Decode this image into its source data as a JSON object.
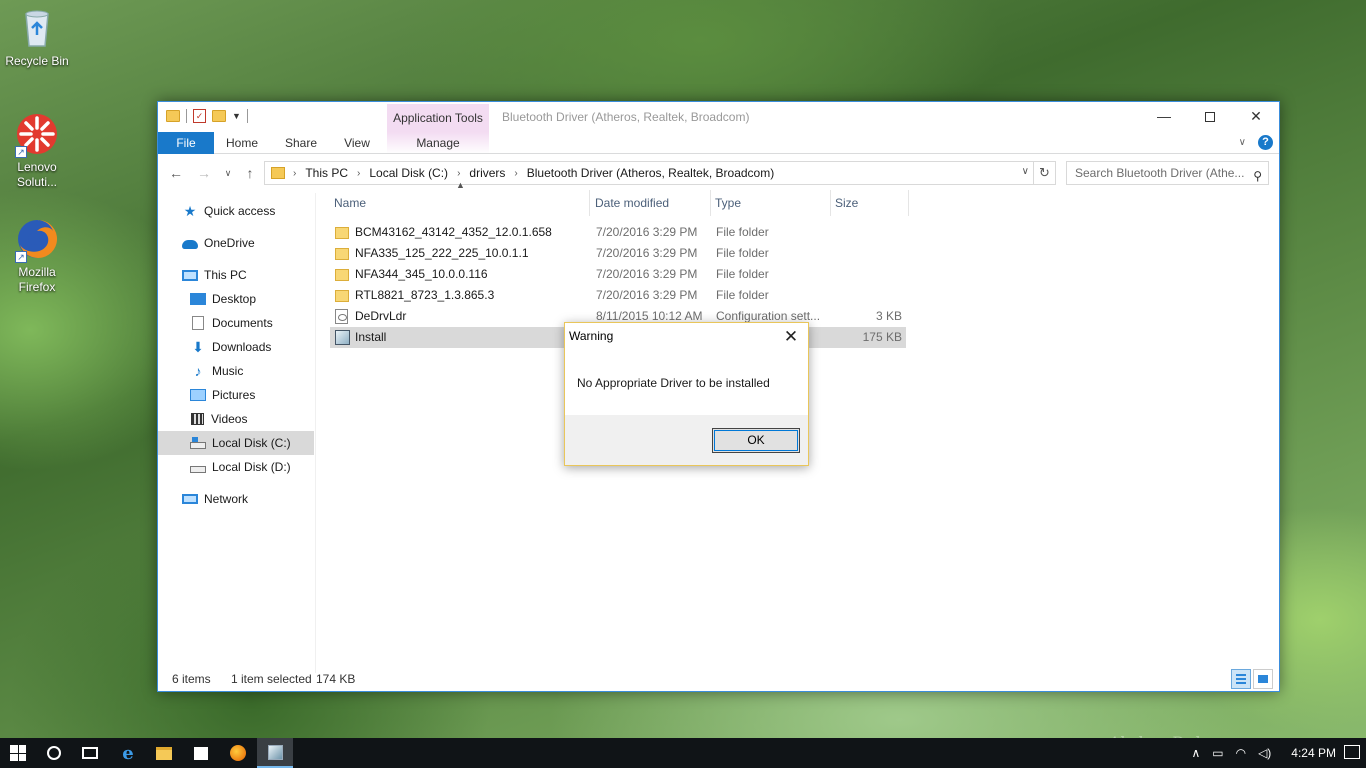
{
  "desktop": {
    "icons": [
      {
        "label": "Recycle Bin",
        "icon": "recycle-bin-icon"
      },
      {
        "label": "Lenovo Soluti...",
        "icon": "lenovo-solutions-icon"
      },
      {
        "label": "Mozilla Firefox",
        "icon": "firefox-icon"
      }
    ]
  },
  "window": {
    "title": "Bluetooth Driver (Atheros, Realtek, Broadcom)",
    "context_tab_group": "Application Tools",
    "ribbon_tabs": [
      "File",
      "Home",
      "Share",
      "View",
      "Manage"
    ],
    "breadcrumb": [
      "This PC",
      "Local Disk (C:)",
      "drivers",
      "Bluetooth Driver (Atheros, Realtek, Broadcom)"
    ],
    "search_placeholder": "Search Bluetooth Driver (Athe...",
    "nav_pane": [
      {
        "label": "Quick access",
        "icon": "star-icon"
      },
      {
        "label": "OneDrive",
        "icon": "cloud-icon"
      },
      {
        "label": "This PC",
        "icon": "computer-icon"
      },
      {
        "label": "Desktop",
        "icon": "desktop-icon"
      },
      {
        "label": "Documents",
        "icon": "documents-icon"
      },
      {
        "label": "Downloads",
        "icon": "downloads-icon"
      },
      {
        "label": "Music",
        "icon": "music-icon"
      },
      {
        "label": "Pictures",
        "icon": "pictures-icon"
      },
      {
        "label": "Videos",
        "icon": "videos-icon"
      },
      {
        "label": "Local Disk (C:)",
        "icon": "drive-icon",
        "selected": true
      },
      {
        "label": "Local Disk (D:)",
        "icon": "drive-icon"
      },
      {
        "label": "Network",
        "icon": "network-icon"
      }
    ],
    "columns": [
      "Name",
      "Date modified",
      "Type",
      "Size"
    ],
    "files": [
      {
        "name": "BCM43162_43142_4352_12.0.1.658",
        "date": "7/20/2016 3:29 PM",
        "type": "File folder",
        "size": "",
        "icon": "folder-icon"
      },
      {
        "name": "NFA335_125_222_225_10.0.1.1",
        "date": "7/20/2016 3:29 PM",
        "type": "File folder",
        "size": "",
        "icon": "folder-icon"
      },
      {
        "name": "NFA344_345_10.0.0.116",
        "date": "7/20/2016 3:29 PM",
        "type": "File folder",
        "size": "",
        "icon": "folder-icon"
      },
      {
        "name": "RTL8821_8723_1.3.865.3",
        "date": "7/20/2016 3:29 PM",
        "type": "File folder",
        "size": "",
        "icon": "folder-icon"
      },
      {
        "name": "DeDrvLdr",
        "date": "8/11/2015 10:12 AM",
        "type": "Configuration sett...",
        "size": "3 KB",
        "icon": "config-file-icon"
      },
      {
        "name": "Install",
        "date": "",
        "type": "",
        "size": "175 KB",
        "icon": "installer-icon",
        "selected": true
      }
    ],
    "status": {
      "items": "6 items",
      "selected": "1 item selected",
      "size": "174 KB"
    }
  },
  "dialog": {
    "title": "Warning",
    "message": "No Appropriate Driver to be installed",
    "ok_label": "OK"
  },
  "taskbar": {
    "time": "4:24 PM",
    "watermark": "Akshay Dubey"
  },
  "colors": {
    "accent": "#1979ca",
    "context_tab": "#f3dcf2",
    "dialog_border": "#e9c65a",
    "taskbar": "#101417"
  }
}
